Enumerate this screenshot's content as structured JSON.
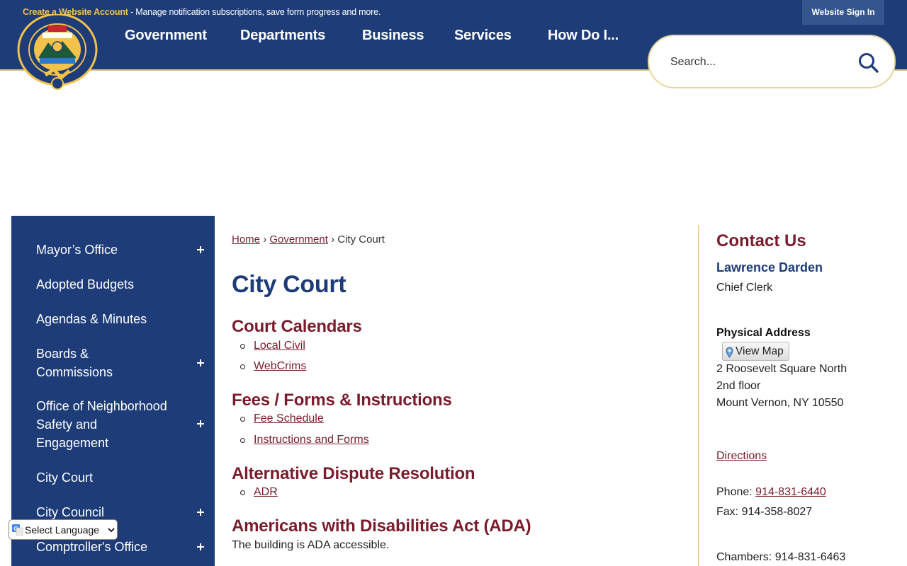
{
  "topbar": {
    "create_account_link": "Create a Website Account",
    "notice_text": " - Manage notification subscriptions, save form progress and more.",
    "sign_in": "Website Sign In"
  },
  "nav": {
    "items": [
      {
        "label": "Government"
      },
      {
        "label": "Departments"
      },
      {
        "label": "Business"
      },
      {
        "label": "Services"
      },
      {
        "label": "How Do I..."
      }
    ]
  },
  "search": {
    "placeholder": "Search..."
  },
  "sidebar": {
    "items": [
      {
        "label": "Mayor’s Office",
        "expandable": true
      },
      {
        "label": "Adopted Budgets",
        "expandable": false
      },
      {
        "label": "Agendas & Minutes",
        "expandable": false
      },
      {
        "label": "Boards & Commissions",
        "expandable": true
      },
      {
        "label": "Office of Neighborhood Safety and Engagement",
        "expandable": true
      },
      {
        "label": "City Court",
        "expandable": false
      },
      {
        "label": "City Council",
        "expandable": true
      },
      {
        "label": "Comptroller's Office",
        "expandable": true
      }
    ]
  },
  "breadcrumb": {
    "home": "Home",
    "government": "Government",
    "separator": "›",
    "current": "City Court"
  },
  "page": {
    "title": "City Court",
    "sections": [
      {
        "heading": "Court Calendars",
        "links": [
          "Local Civil",
          "WebCrims"
        ]
      },
      {
        "heading": "Fees / Forms & Instructions",
        "links": [
          "Fee Schedule",
          "Instructions and Forms"
        ]
      },
      {
        "heading": "Alternative Dispute Resolution",
        "links": [
          "ADR"
        ]
      },
      {
        "heading": "Americans with Disabilities Act (ADA)",
        "text": "The building is ADA accessible."
      }
    ]
  },
  "contact": {
    "title": "Contact Us",
    "name": "Lawrence Darden",
    "role": "Chief Clerk",
    "address_heading": "Physical Address",
    "view_map": "View Map",
    "address_line1": "2 Roosevelt Square North",
    "address_line2": "2nd floor",
    "address_line3": "Mount Vernon, NY 10550",
    "directions": "Directions",
    "phone_label": "Phone: ",
    "phone": "914-831-6440",
    "fax": "Fax: 914-358-8027",
    "chambers": "Chambers: 914-831-6463"
  },
  "translate": {
    "label": "Select Language"
  },
  "colors": {
    "navy": "#1d3c78",
    "maroon": "#7a1c2b",
    "gold": "#f3c24b"
  }
}
